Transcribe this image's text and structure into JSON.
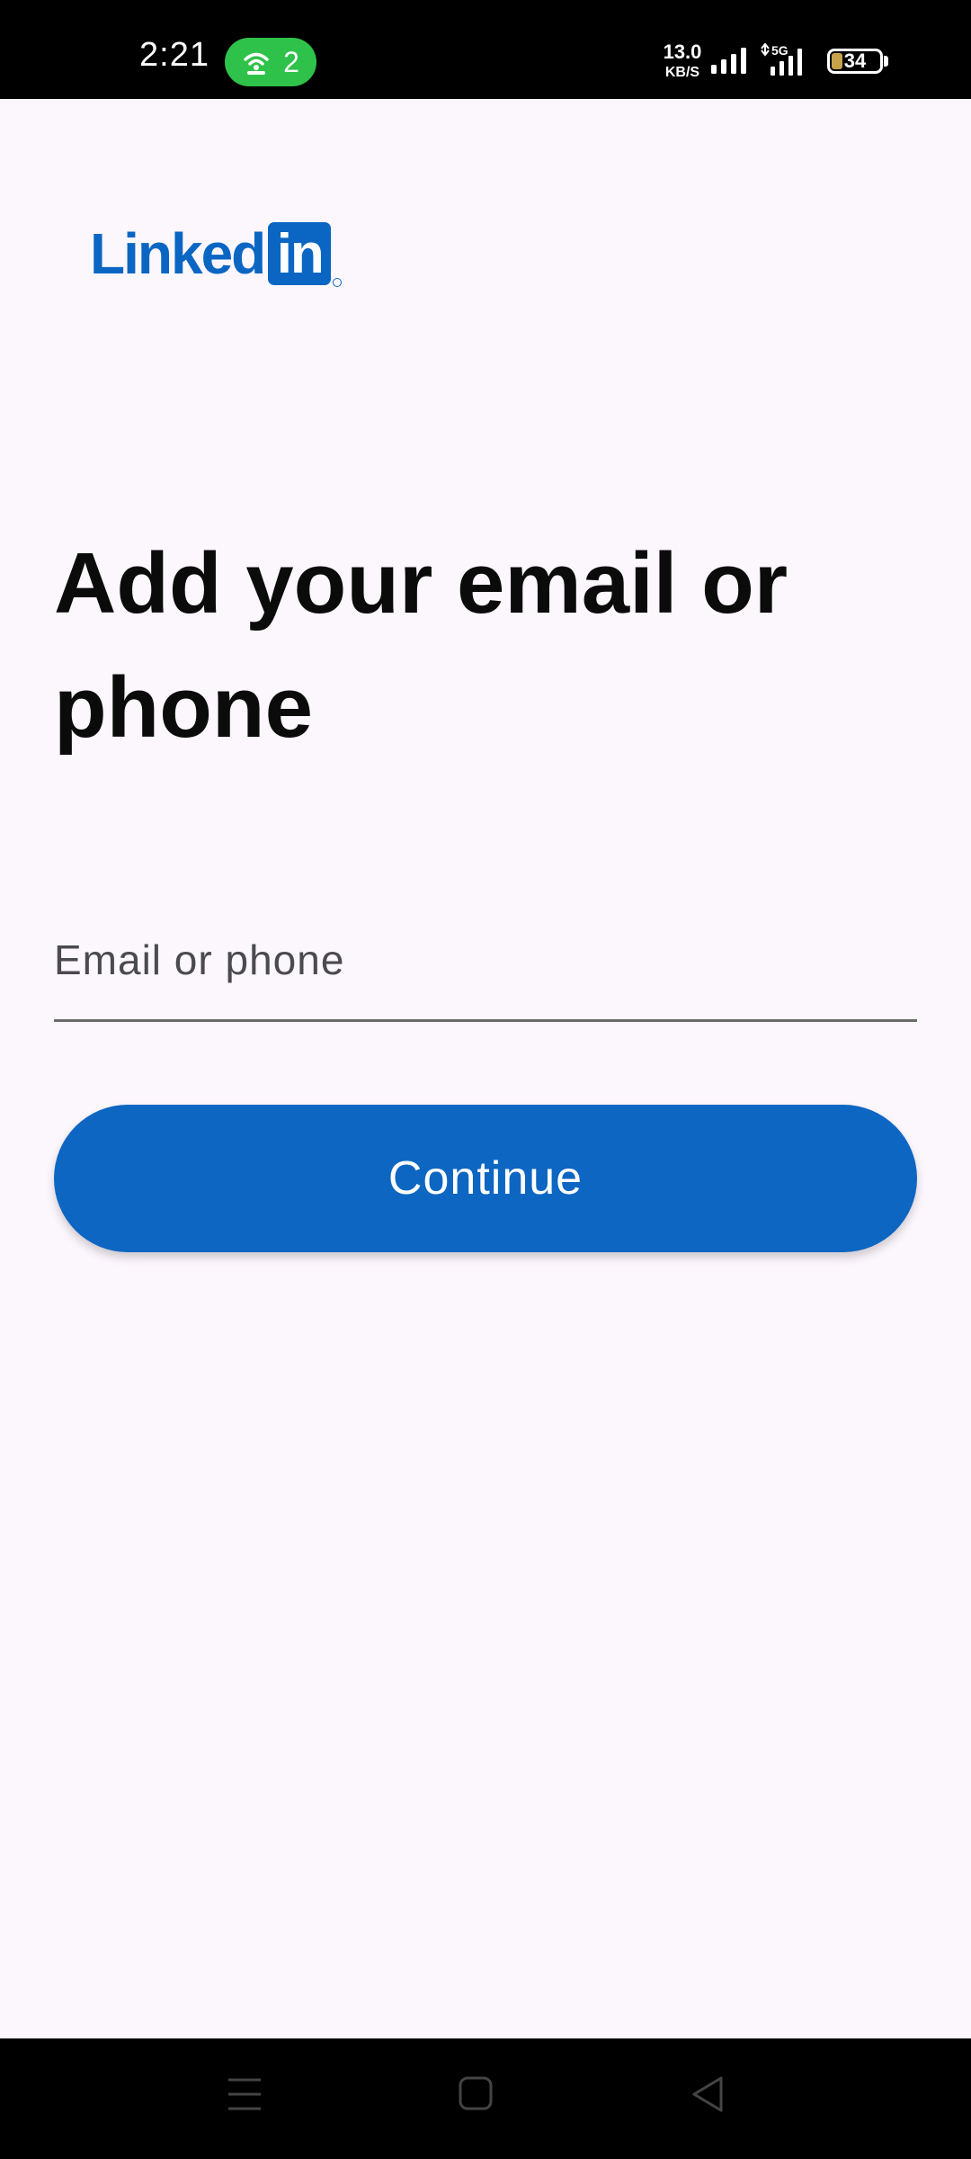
{
  "status_bar": {
    "time": "2:21",
    "hotspot_count": "2",
    "net_speed_value": "13.0",
    "net_speed_unit": "KB/S",
    "network_type": "5G",
    "battery_level": "34",
    "icons": [
      "hotspot-icon",
      "signal-icon",
      "5g-signal-icon",
      "battery-icon"
    ]
  },
  "brand": {
    "logo_text": "Linked",
    "logo_box_text": "in",
    "color": "#0a66c2"
  },
  "main": {
    "title": "Add your email or phone",
    "email_field": {
      "placeholder": "Email or phone",
      "value": ""
    },
    "continue_label": "Continue"
  },
  "nav_bar": {
    "icons": [
      "menu-icon",
      "home-icon",
      "back-icon"
    ]
  },
  "colors": {
    "accent": "#0d66c2",
    "background": "#fcf6fd"
  }
}
